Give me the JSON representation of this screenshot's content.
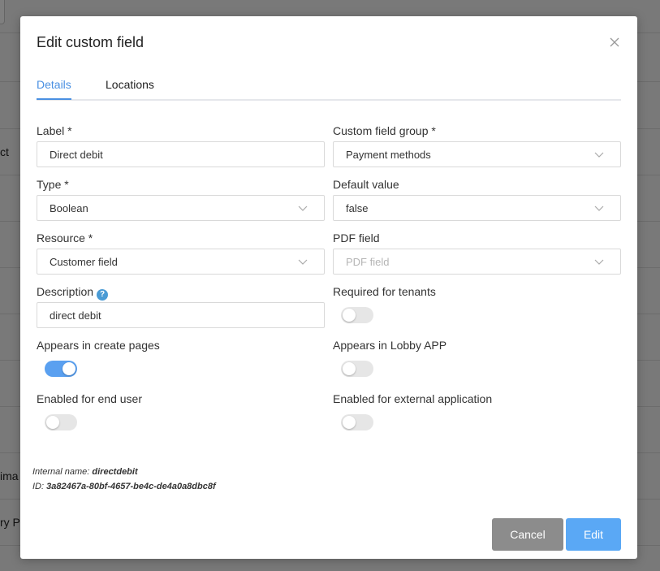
{
  "background": {
    "row_texts": [
      "ct",
      "ima",
      "ry P"
    ]
  },
  "modal": {
    "title": "Edit custom field",
    "tabs": [
      {
        "label": "Details",
        "active": true
      },
      {
        "label": "Locations",
        "active": false
      }
    ],
    "fields": {
      "label": {
        "label": "Label *",
        "value": "Direct debit"
      },
      "custom_field_group": {
        "label": "Custom field group *",
        "value": "Payment methods"
      },
      "type": {
        "label": "Type *",
        "value": "Boolean"
      },
      "default_value": {
        "label": "Default value",
        "value": "false"
      },
      "resource": {
        "label": "Resource *",
        "value": "Customer field"
      },
      "pdf_field": {
        "label": "PDF field",
        "placeholder": "PDF field"
      },
      "description": {
        "label": "Description",
        "value": "direct debit"
      }
    },
    "toggles": {
      "required_for_tenants": {
        "label": "Required for tenants",
        "on": false
      },
      "appears_in_create_pages": {
        "label": "Appears in create pages",
        "on": true
      },
      "appears_in_lobby_app": {
        "label": "Appears in Lobby APP",
        "on": false
      },
      "enabled_for_end_user": {
        "label": "Enabled for end user",
        "on": false
      },
      "enabled_for_external_application": {
        "label": "Enabled for external application",
        "on": false
      }
    },
    "meta": {
      "internal_name_label": "Internal name:",
      "internal_name": "directdebit",
      "id_label": "ID:",
      "id": "3a82467a-80bf-4657-be4c-de4a0a8dbc8f"
    },
    "buttons": {
      "cancel": "Cancel",
      "edit": "Edit"
    }
  },
  "colors": {
    "accent": "#4a90e2",
    "toggle_on": "#5aa0f0",
    "cancel_button": "#8c8c8c",
    "edit_button": "#5aa8f5"
  }
}
